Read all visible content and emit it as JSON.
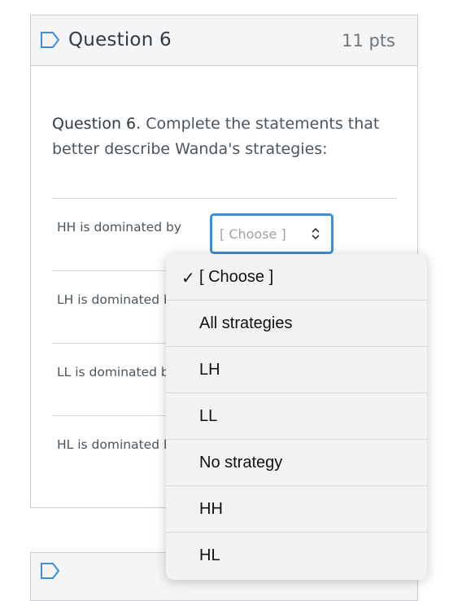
{
  "question": {
    "title": "Question 6",
    "points": "11 pts",
    "text_lead": "Question 6.",
    "text_rest": " Complete the statements that better describe Wanda's strategies:"
  },
  "rows": [
    {
      "label": "HH is dominated by",
      "select_value": "[ Choose ]"
    },
    {
      "label": "LH is dominated b"
    },
    {
      "label": "LL is dominated b"
    },
    {
      "label": "HL is dominated b"
    }
  ],
  "dropdown": {
    "options": [
      {
        "label": "[ Choose ]",
        "checked": true
      },
      {
        "label": "All strategies"
      },
      {
        "label": "LH"
      },
      {
        "label": "LL"
      },
      {
        "label": "No strategy"
      },
      {
        "label": "HH"
      },
      {
        "label": "HL"
      }
    ],
    "check_glyph": "✓"
  },
  "colors": {
    "accent": "#3a8ee0",
    "header_bg": "#f5f5f5",
    "border": "#c7cdd1"
  }
}
